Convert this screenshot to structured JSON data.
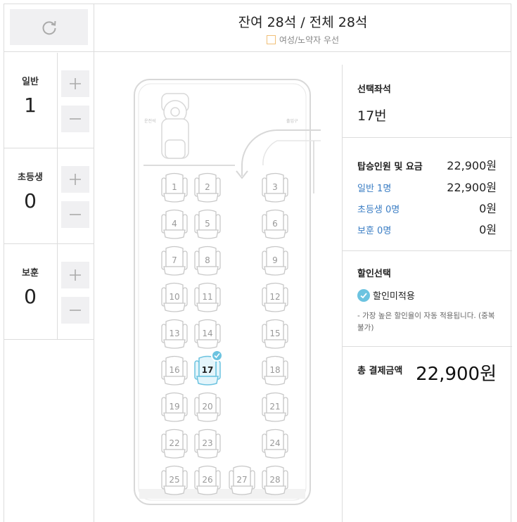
{
  "header": {
    "title": "잔여 28석 / 전체 28석",
    "legend_label": "여성/노약자 우선"
  },
  "counters": [
    {
      "label": "일반",
      "count": "1"
    },
    {
      "label": "초등생",
      "count": "0"
    },
    {
      "label": "보훈",
      "count": "0"
    }
  ],
  "bus": {
    "driver_label": "운전석",
    "door_label": "출입구",
    "selected_seat": 17,
    "seats": [
      {
        "number": "1",
        "col": 0,
        "row": 0
      },
      {
        "number": "2",
        "col": 1,
        "row": 0
      },
      {
        "number": "3",
        "col": 3,
        "row": 0
      },
      {
        "number": "4",
        "col": 0,
        "row": 1
      },
      {
        "number": "5",
        "col": 1,
        "row": 1
      },
      {
        "number": "6",
        "col": 3,
        "row": 1
      },
      {
        "number": "7",
        "col": 0,
        "row": 2
      },
      {
        "number": "8",
        "col": 1,
        "row": 2
      },
      {
        "number": "9",
        "col": 3,
        "row": 2
      },
      {
        "number": "10",
        "col": 0,
        "row": 3
      },
      {
        "number": "11",
        "col": 1,
        "row": 3
      },
      {
        "number": "12",
        "col": 3,
        "row": 3
      },
      {
        "number": "13",
        "col": 0,
        "row": 4
      },
      {
        "number": "14",
        "col": 1,
        "row": 4
      },
      {
        "number": "15",
        "col": 3,
        "row": 4
      },
      {
        "number": "16",
        "col": 0,
        "row": 5
      },
      {
        "number": "17",
        "col": 1,
        "row": 5
      },
      {
        "number": "18",
        "col": 3,
        "row": 5
      },
      {
        "number": "19",
        "col": 0,
        "row": 6
      },
      {
        "number": "20",
        "col": 1,
        "row": 6
      },
      {
        "number": "21",
        "col": 3,
        "row": 6
      },
      {
        "number": "22",
        "col": 0,
        "row": 7
      },
      {
        "number": "23",
        "col": 1,
        "row": 7
      },
      {
        "number": "24",
        "col": 3,
        "row": 7
      },
      {
        "number": "25",
        "col": 0,
        "row": 8
      },
      {
        "number": "26",
        "col": 1,
        "row": 8
      },
      {
        "number": "27",
        "col": 2,
        "row": 8
      },
      {
        "number": "28",
        "col": 3,
        "row": 8
      }
    ]
  },
  "selection": {
    "title": "선택좌석",
    "value": "17번"
  },
  "fare": {
    "title": "탑승인원 및 요금",
    "total": "22,900원",
    "rows": [
      {
        "label": "일반 1명",
        "amount": "22,900원"
      },
      {
        "label": "초등생 0명",
        "amount": "0원"
      },
      {
        "label": "보훈 0명",
        "amount": "0원"
      }
    ]
  },
  "discount": {
    "title": "할인선택",
    "option": "할인미적용",
    "note": "- 가장 높은 할인율이 자동 적용됩니다. (중복불가)"
  },
  "payment": {
    "title": "총 결제금액",
    "amount": "22,900원"
  },
  "colors": {
    "selected_seat": "#6cc3e0",
    "link_blue": "#3a7dc4",
    "priority_legend": "#f0c078",
    "button_bg": "#f0f0f2"
  }
}
